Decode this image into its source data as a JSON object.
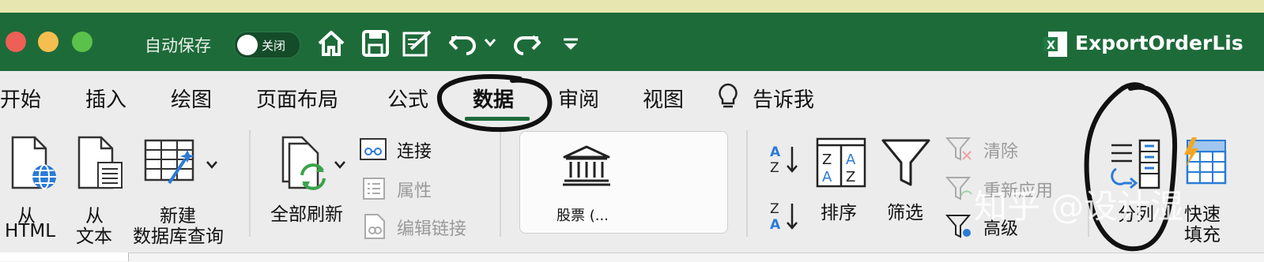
{
  "window": {
    "title": "ExportOrderLis",
    "traffic_lights": {
      "close": "#ed5f57",
      "minimize": "#f5be4f",
      "zoom": "#5ac24a"
    }
  },
  "quick_access": {
    "autosave_label": "自动保存",
    "autosave_state": "关闭",
    "icons": [
      "home-icon",
      "save-icon",
      "edit-document-icon",
      "undo-icon",
      "redo-icon",
      "customize-toolbar-icon"
    ]
  },
  "tabs": [
    {
      "label": "开始"
    },
    {
      "label": "插入"
    },
    {
      "label": "绘图"
    },
    {
      "label": "页面布局"
    },
    {
      "label": "公式"
    },
    {
      "label": "数据",
      "active": true
    },
    {
      "label": "审阅"
    },
    {
      "label": "视图"
    },
    {
      "label": "告诉我"
    }
  ],
  "ribbon": {
    "get_data": {
      "from_html_line1": "从",
      "from_html_line2": "HTML",
      "from_text_line1": "从",
      "from_text_line2": "文本",
      "new_db_query_line1": "新建",
      "new_db_query_line2": "数据库查询"
    },
    "queries": {
      "refresh_all": "全部刷新",
      "connections": "连接",
      "properties": "属性",
      "edit_links": "编辑链接"
    },
    "data_types": {
      "stocks": "股票 (..."
    },
    "sort_filter": {
      "sort": "排序",
      "filter": "筛选",
      "clear": "清除",
      "reapply": "重新应用",
      "advanced": "高级"
    },
    "data_tools": {
      "text_to_columns": "分列",
      "flash_fill_line1": "快速",
      "flash_fill_line2": "填充"
    }
  },
  "watermark": "知乎 @设计湿",
  "colors": {
    "title_bar": "#1e6b3a",
    "accent": "#1e6b3a",
    "ribbon_bg": "#ececec",
    "icon_blue": "#2b7bd6",
    "icon_green": "#3aa34a"
  }
}
